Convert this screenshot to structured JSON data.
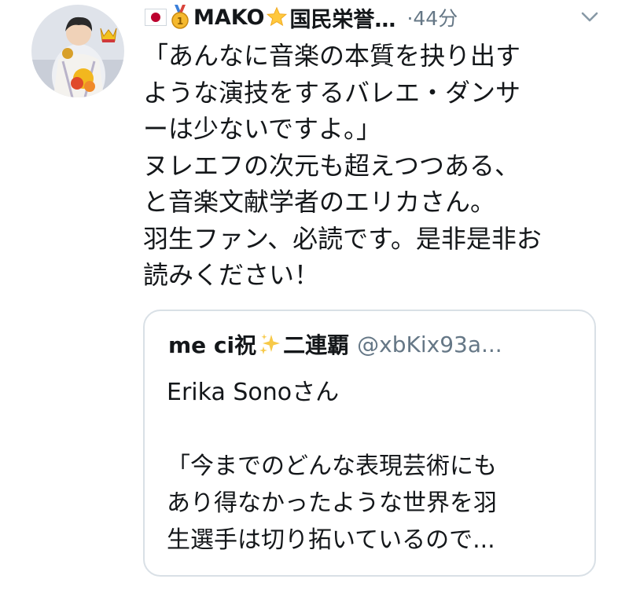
{
  "tweet": {
    "author": {
      "display_name": "MAKO",
      "name_suffix": "国民栄誉…",
      "flag_icon": "japan-flag-icon",
      "medal_icon": "gold-medal-icon",
      "star_icon": "star-icon"
    },
    "time": "·44分",
    "text_lines": [
      "「あんなに音楽の本質を抉り出す",
      "ような演技をするバレエ・ダンサ",
      "ーは少ないですよ。」",
      "ヌレエフの次元も超えつつある、",
      "と音楽文献学者のエリカさん。",
      "羽生ファン、必読です。是非是非お",
      "読みください！"
    ],
    "quoted": {
      "name_part1": "me ci祝",
      "name_part2": "二連覇",
      "handle": "@xbKix93a...",
      "text_lines": [
        "Erika Sonoさん",
        "",
        "「今までのどんな表現芸術にも",
        "あり得なかったような世界を羽",
        "生選手は切り拓いているので..."
      ]
    }
  },
  "colors": {
    "text": "#14171a",
    "secondary": "#657786",
    "border": "#d9e0e6",
    "star": "#ffc83d",
    "gold": "#f5b92e",
    "flag_red": "#bc002d"
  }
}
